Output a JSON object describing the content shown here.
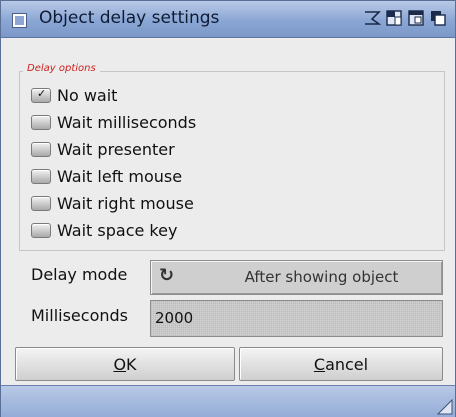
{
  "window": {
    "title": "Object delay settings"
  },
  "group": {
    "label": "Delay options"
  },
  "options": [
    {
      "label": "No wait",
      "checked": true
    },
    {
      "label": "Wait milliseconds",
      "checked": false
    },
    {
      "label": "Wait presenter",
      "checked": false
    },
    {
      "label": "Wait left mouse",
      "checked": false
    },
    {
      "label": "Wait right mouse",
      "checked": false
    },
    {
      "label": "Wait space key",
      "checked": false
    }
  ],
  "delay_mode": {
    "label": "Delay mode",
    "value": "After showing object",
    "icon": "cycle-icon"
  },
  "milliseconds": {
    "label": "Milliseconds",
    "value": "2000"
  },
  "buttons": {
    "ok_underlined": "O",
    "ok_rest": "K",
    "cancel_underlined": "C",
    "cancel_rest": "ancel"
  },
  "colors": {
    "titlebar": "#8aa6d4",
    "group_label": "#cc2222",
    "window_bg": "#ececec"
  }
}
